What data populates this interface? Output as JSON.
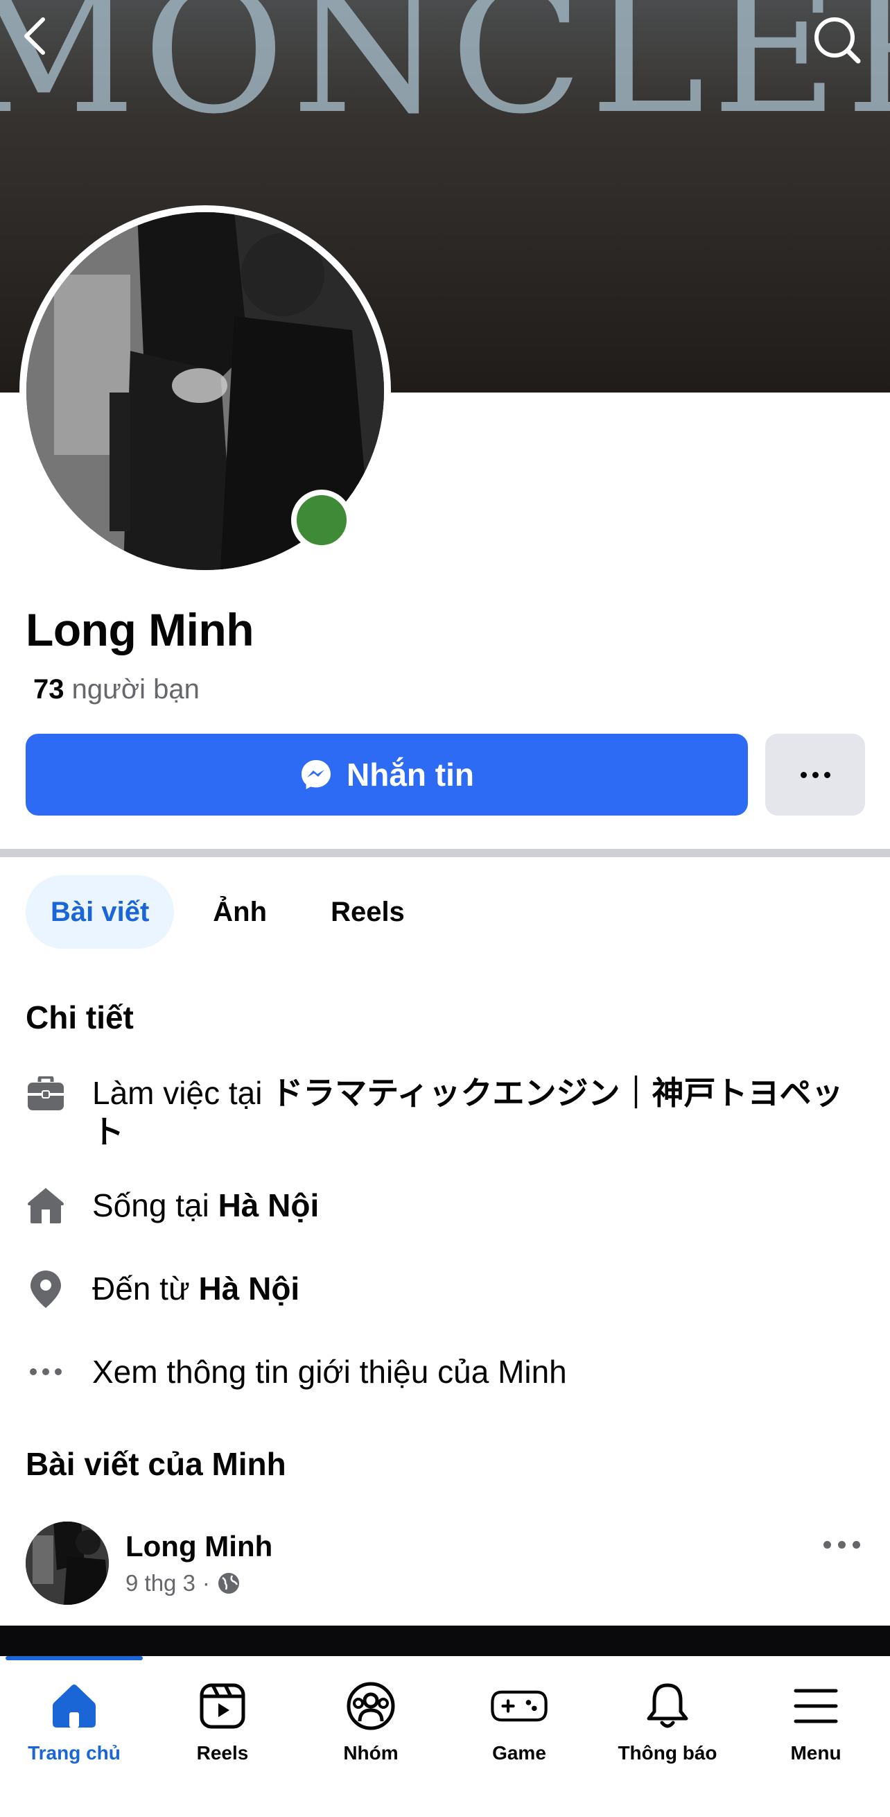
{
  "cover": {
    "text": "MONCLER"
  },
  "profile": {
    "name": "Long Minh",
    "friends_count": "73",
    "friends_label": "người bạn"
  },
  "actions": {
    "message_label": "Nhắn tin"
  },
  "tabs": [
    {
      "label": "Bài viết",
      "active": true
    },
    {
      "label": "Ảnh",
      "active": false
    },
    {
      "label": "Reels",
      "active": false
    }
  ],
  "details": {
    "title": "Chi tiết",
    "work_prefix": "Làm việc tại ",
    "work_place_line1": "ドラマティックエンジン｜神戸トヨペッ",
    "work_place_line2": "ト",
    "lives_prefix": "Sống tại ",
    "lives_place": "Hà Nội",
    "from_prefix": "Đến từ ",
    "from_place": "Hà Nội",
    "see_about": "Xem thông tin giới thiệu của Minh"
  },
  "posts": {
    "title": "Bài viết của Minh",
    "author": "Long Minh",
    "date": "9 thg 3",
    "separator": "·"
  },
  "bottom_nav": [
    {
      "label": "Trang chủ",
      "icon": "home-icon",
      "active": true
    },
    {
      "label": "Reels",
      "icon": "reels-icon",
      "active": false
    },
    {
      "label": "Nhóm",
      "icon": "groups-icon",
      "active": false
    },
    {
      "label": "Game",
      "icon": "gamepad-icon",
      "active": false
    },
    {
      "label": "Thông báo",
      "icon": "bell-icon",
      "active": false
    },
    {
      "label": "Menu",
      "icon": "menu-icon",
      "active": false
    }
  ],
  "colors": {
    "accent": "#2d6bf5",
    "active_tab": "#1a66d6",
    "online": "#3e8a36"
  }
}
